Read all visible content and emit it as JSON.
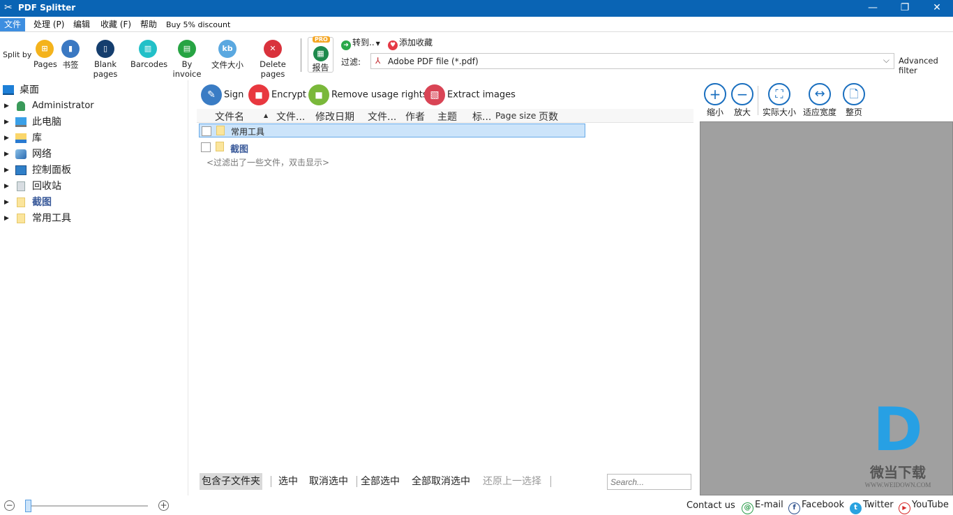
{
  "window": {
    "title": "PDF Splitter",
    "controls": {
      "minimize": "—",
      "restore": "❐",
      "close": "✕"
    }
  },
  "menu": {
    "items": [
      "文件",
      "处理 (P)",
      "编辑",
      "收藏 (F)",
      "帮助",
      "Buy 5% discount"
    ]
  },
  "ribbon": {
    "split_by_label": "Split by",
    "split_buttons": [
      {
        "label": "Pages",
        "icon": "pages-icon",
        "color": "#f4b31c",
        "glyph": "⊞"
      },
      {
        "label": "书签",
        "icon": "bookmark-icon",
        "color": "#3a78c2",
        "glyph": "▮"
      },
      {
        "label": "Blank pages",
        "icon": "blank-page-icon",
        "color": "#153e6e",
        "glyph": "▯"
      },
      {
        "label": "Barcodes",
        "icon": "barcode-icon",
        "color": "#22c0c8",
        "glyph": "▥"
      },
      {
        "label": "By invoice",
        "icon": "invoice-icon",
        "color": "#27a443",
        "glyph": "▤"
      },
      {
        "label": "文件大小",
        "icon": "file-size-icon",
        "color": "#5aa8e0",
        "glyph": "kb"
      },
      {
        "label": "Delete pages",
        "icon": "delete-pages-icon",
        "color": "#d9323c",
        "glyph": "✕"
      }
    ],
    "report": {
      "label": "报告",
      "badge": "PRO"
    },
    "goto_label": "转到..",
    "favorite_label": "添加收藏",
    "filter_label": "过滤:",
    "filter_value": "Adobe PDF file (*.pdf)",
    "advanced_filter": "Advanced filter"
  },
  "tree": {
    "items": [
      {
        "label": "桌面",
        "icon": "desktop-icon",
        "expandable": false
      },
      {
        "label": "Administrator",
        "icon": "user-icon",
        "expandable": true
      },
      {
        "label": "此电脑",
        "icon": "computer-icon",
        "expandable": true
      },
      {
        "label": "库",
        "icon": "library-icon",
        "expandable": true
      },
      {
        "label": "网络",
        "icon": "network-icon",
        "expandable": true
      },
      {
        "label": "控制面板",
        "icon": "control-panel-icon",
        "expandable": true
      },
      {
        "label": "回收站",
        "icon": "recycle-bin-icon",
        "expandable": true
      },
      {
        "label": "截图",
        "icon": "folder-icon",
        "expandable": true,
        "bold": true
      },
      {
        "label": "常用工具",
        "icon": "folder-shortcut-icon",
        "expandable": true
      }
    ]
  },
  "actions": [
    {
      "label": "Sign",
      "icon": "sign-icon",
      "color": "#3a7cc4",
      "glyph": "✎"
    },
    {
      "label": "Encrypt",
      "icon": "lock-icon",
      "color": "#e8383f",
      "glyph": "🔒"
    },
    {
      "label": "Remove usage rights",
      "icon": "unlock-icon",
      "color": "#7ab83a",
      "glyph": "🔓"
    },
    {
      "label": "Extract images",
      "icon": "extract-images-icon",
      "color": "#d94455",
      "glyph": "▧"
    }
  ],
  "file_list": {
    "columns": [
      "文件名",
      "▲",
      "文件...",
      "修改日期",
      "文件...",
      "作者",
      "主题",
      "标...",
      "Page size",
      "页数"
    ],
    "rows": [
      {
        "name": "常用工具",
        "selected": true,
        "bold": false
      },
      {
        "name": "截图",
        "selected": false,
        "bold": true
      }
    ],
    "filtered_note": "<过滤出了一些文件，双击显示>"
  },
  "bottom_bar": {
    "include_subfolders": "包含子文件夹",
    "select": "选中",
    "deselect": "取消选中",
    "select_all": "全部选中",
    "deselect_all": "全部取消选中",
    "restore_selection": "还原上一选择",
    "search_placeholder": "Search..."
  },
  "preview": {
    "buttons": [
      {
        "label": "缩小",
        "icon": "zoom-in-icon",
        "glyph": "+"
      },
      {
        "label": "放大",
        "icon": "zoom-out-icon",
        "glyph": "−"
      },
      {
        "label": "实际大小",
        "icon": "actual-size-icon",
        "glyph": "⛶"
      },
      {
        "label": "适应宽度",
        "icon": "fit-width-icon",
        "glyph": "↔"
      },
      {
        "label": "整页",
        "icon": "full-page-icon",
        "glyph": "🗋"
      }
    ],
    "watermark": {
      "letter": "D",
      "name": "微当下载",
      "url": "WWW.WEIDOWN.COM"
    }
  },
  "status": {
    "zoom_level": 0,
    "contact_label": "Contact us",
    "links": [
      {
        "label": "E-mail",
        "icon": "email-icon",
        "color": "#2a9d4a",
        "glyph": "@"
      },
      {
        "label": "Facebook",
        "icon": "facebook-icon",
        "color": "#2b4f8c",
        "glyph": "f"
      },
      {
        "label": "Twitter",
        "icon": "twitter-icon",
        "color": "#2aa3e0",
        "glyph": "t"
      },
      {
        "label": "YouTube",
        "icon": "youtube-icon",
        "color": "#d62828",
        "glyph": "▶"
      }
    ]
  }
}
